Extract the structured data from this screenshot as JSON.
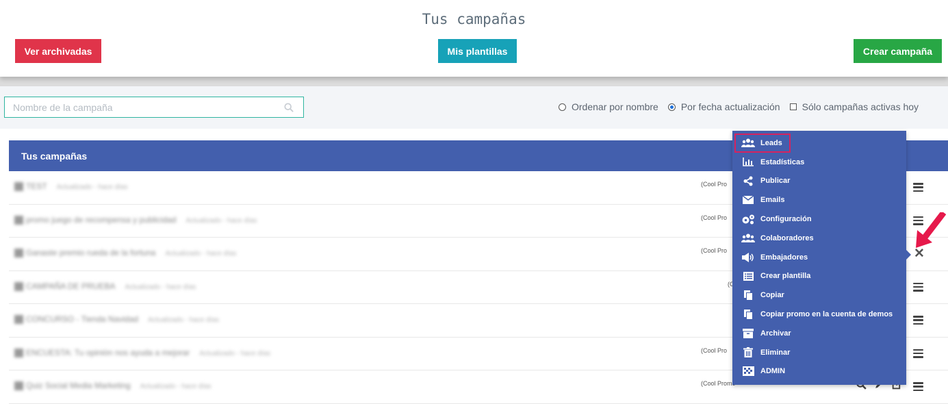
{
  "header": {
    "title": "Tus campañas",
    "archived_label": "Ver archivadas",
    "templates_label": "Mis plantillas",
    "create_label": "Crear campaña",
    "colors": {
      "archived": "#e0344a",
      "templates": "#17a2b8",
      "create": "#28a745"
    }
  },
  "filters": {
    "search_placeholder": "Nombre de la campaña",
    "sort_by_name": "Ordenar por nombre",
    "sort_by_update": "Por fecha actualización",
    "only_active": "Sólo campañas activas hoy",
    "selected_sort": "Por fecha actualización",
    "only_active_checked": false
  },
  "table": {
    "header": "Tus campañas",
    "accent_color": "#435fad",
    "rows": [
      {
        "name": "TEST",
        "sub": "Actualizado - hace días",
        "tag": "(Cool Pro"
      },
      {
        "name": "promo juego de recompensa y publicidad",
        "sub": "Actualizado - hace días",
        "tag": "(Cool Pro"
      },
      {
        "name": "Ganaste premio rueda de la fortuna",
        "sub": "Actualizado - hace días",
        "tag": "(Cool Pro"
      },
      {
        "name": "CAMPAÑA DE PRUEBA",
        "sub": "Actualizado - hace días",
        "tag": "(C"
      },
      {
        "name": "CONCURSO - Tienda Navidad",
        "sub": "Actualizado - hace días",
        "tag": ""
      },
      {
        "name": "ENCUESTA: Tu opinión nos ayuda a mejorar",
        "sub": "Actualizado - hace días",
        "tag": "(Cool Pro"
      },
      {
        "name": "Quiz Social Media Marketing",
        "sub": "Actualizado - hace días",
        "tag": "(Cool Promo"
      }
    ]
  },
  "dropdown": {
    "items": [
      {
        "label": "Leads",
        "icon": "users-icon"
      },
      {
        "label": "Estadísticas",
        "icon": "bar-chart-icon"
      },
      {
        "label": "Publicar",
        "icon": "share-icon"
      },
      {
        "label": "Emails",
        "icon": "envelope-icon"
      },
      {
        "label": "Configuración",
        "icon": "gears-icon"
      },
      {
        "label": "Colaboradores",
        "icon": "users-icon"
      },
      {
        "label": "Embajadores",
        "icon": "megaphone-icon"
      },
      {
        "label": "Crear plantilla",
        "icon": "list-icon"
      },
      {
        "label": "Copiar",
        "icon": "copy-icon"
      },
      {
        "label": "Copiar promo en la cuenta de demos",
        "icon": "copy-icon"
      },
      {
        "label": "Archivar",
        "icon": "archive-icon"
      },
      {
        "label": "Eliminar",
        "icon": "trash-icon"
      },
      {
        "label": "ADMIN",
        "icon": "checkered-flag-icon"
      }
    ],
    "highlighted": "Leads"
  }
}
